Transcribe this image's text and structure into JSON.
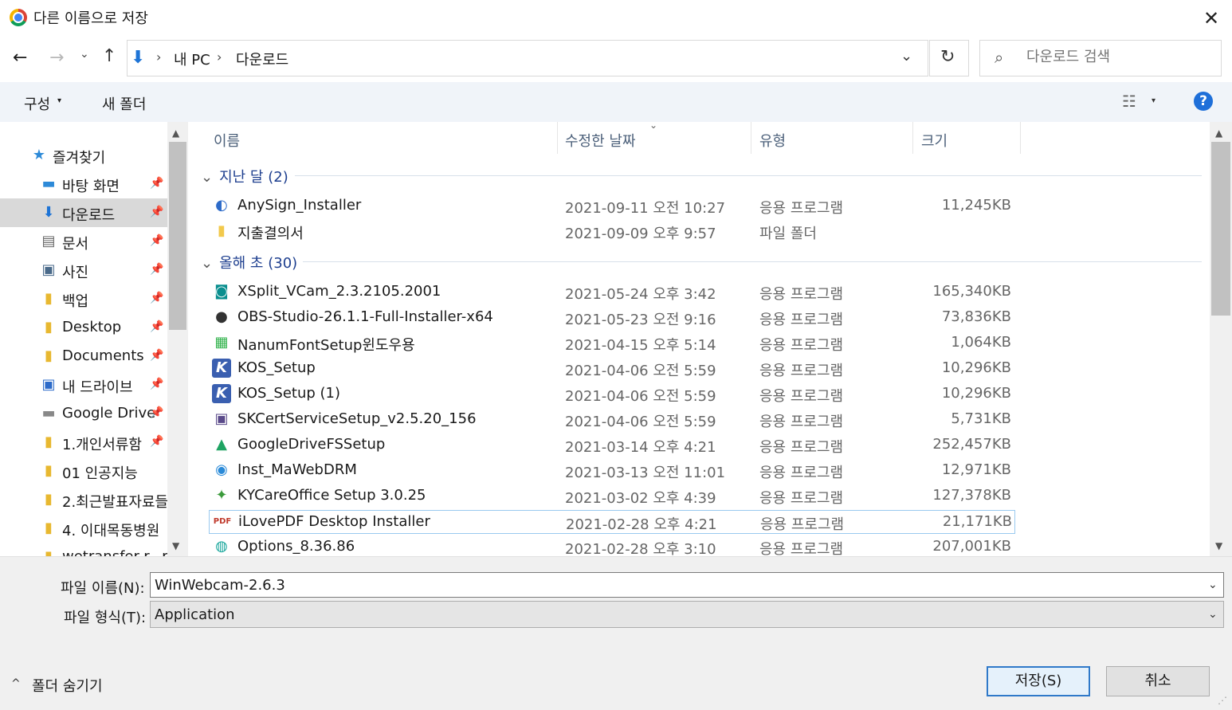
{
  "window": {
    "title": "다른 이름으로 저장",
    "close": "✕"
  },
  "nav": {
    "back": "←",
    "forward": "→",
    "recent": "⌄",
    "up": "↑"
  },
  "address": {
    "icon": "download-arrow-icon",
    "sep": "›",
    "crumbs": [
      "내 PC",
      "다운로드"
    ],
    "dropdown": "⌄"
  },
  "refresh": "↻",
  "search": {
    "placeholder": "다운로드 검색",
    "icon": "⌕"
  },
  "toolbar": {
    "organize": "구성",
    "organize_arrow": "▾",
    "new_folder": "새 폴더",
    "view_icon": "☷",
    "view_arrow": "▾",
    "help": "?"
  },
  "sidebar": {
    "items": [
      {
        "label": "즐겨찾기",
        "icon": "★",
        "pin": ""
      },
      {
        "label": "바탕 화면",
        "icon": "▬",
        "pin": "📌"
      },
      {
        "label": "다운로드",
        "icon": "⬇",
        "pin": "📌"
      },
      {
        "label": "문서",
        "icon": "▤",
        "pin": "📌"
      },
      {
        "label": "사진",
        "icon": "▣",
        "pin": "📌"
      },
      {
        "label": "백업",
        "icon": "▮",
        "pin": "📌"
      },
      {
        "label": "Desktop",
        "icon": "▮",
        "pin": "📌"
      },
      {
        "label": "Documents",
        "icon": "▮",
        "pin": "📌"
      },
      {
        "label": "내 드라이브",
        "icon": "▣",
        "pin": "📌"
      },
      {
        "label": "Google Drive",
        "icon": "▬",
        "pin": "📌"
      },
      {
        "label": "1.개인서류함",
        "icon": "▮",
        "pin": "📌"
      },
      {
        "label": "01 인공지능",
        "icon": "▮",
        "pin": ""
      },
      {
        "label": "2.최근발표자료들",
        "icon": "▮",
        "pin": ""
      },
      {
        "label": "4. 이대목동병원",
        "icon": "▮",
        "pin": ""
      },
      {
        "label": "wetransfer-r...p",
        "icon": "▮",
        "pin": ""
      }
    ]
  },
  "columns": {
    "name": "이름",
    "modified": "수정한 날짜",
    "type": "유형",
    "size": "크기",
    "sort": "⌄"
  },
  "groups": [
    {
      "header": "지난 달 (2)",
      "toggle": "⌄",
      "files": [
        {
          "name": "AnySign_Installer",
          "date": "2021-09-11 오전 10:27",
          "type": "응용 프로그램",
          "size": "11,245KB",
          "icon": "◐",
          "color": "#2d6bc9"
        },
        {
          "name": "지출결의서",
          "date": "2021-09-09 오후 9:57",
          "type": "파일 폴더",
          "size": "",
          "icon": "▮",
          "color": "#f2c94c"
        }
      ]
    },
    {
      "header": "올해 초 (30)",
      "toggle": "⌄",
      "files": [
        {
          "name": "XSplit_VCam_2.3.2105.2001",
          "date": "2021-05-24 오후 3:42",
          "type": "응용 프로그램",
          "size": "165,340KB",
          "icon": "◙",
          "color": "#0a8f8f"
        },
        {
          "name": "OBS-Studio-26.1.1-Full-Installer-x64",
          "date": "2021-05-23 오전 9:16",
          "type": "응용 프로그램",
          "size": "73,836KB",
          "icon": "●",
          "color": "#333333"
        },
        {
          "name": "NanumFontSetup윈도우용",
          "date": "2021-04-15 오후 5:14",
          "type": "응용 프로그램",
          "size": "1,064KB",
          "icon": "▦",
          "color": "#2fb24a"
        },
        {
          "name": "KOS_Setup",
          "date": "2021-04-06 오전 5:59",
          "type": "응용 프로그램",
          "size": "10,296KB",
          "icon": "K",
          "color": "#3a5fb0"
        },
        {
          "name": "KOS_Setup (1)",
          "date": "2021-04-06 오전 5:59",
          "type": "응용 프로그램",
          "size": "10,296KB",
          "icon": "K",
          "color": "#3a5fb0"
        },
        {
          "name": "SKCertServiceSetup_v2.5.20_156",
          "date": "2021-04-06 오전 5:59",
          "type": "응용 프로그램",
          "size": "5,731KB",
          "icon": "▣",
          "color": "#5a4a8a"
        },
        {
          "name": "GoogleDriveFSSetup",
          "date": "2021-03-14 오후 4:21",
          "type": "응용 프로그램",
          "size": "252,457KB",
          "icon": "▲",
          "color": "#1fa463"
        },
        {
          "name": "Inst_MaWebDRM",
          "date": "2021-03-13 오전 11:01",
          "type": "응용 프로그램",
          "size": "12,971KB",
          "icon": "◉",
          "color": "#2a8ad8"
        },
        {
          "name": "KYCareOffice Setup 3.0.25",
          "date": "2021-03-02 오후 4:39",
          "type": "응용 프로그램",
          "size": "127,378KB",
          "icon": "✦",
          "color": "#3c9b3c"
        },
        {
          "name": "iLovePDF Desktop Installer",
          "date": "2021-02-28 오후 4:21",
          "type": "응용 프로그램",
          "size": "21,171KB",
          "icon": "PDF",
          "color": "#c0392b"
        },
        {
          "name": "Options_8.36.86",
          "date": "2021-02-28 오후 3:10",
          "type": "응용 프로그램",
          "size": "207,001KB",
          "icon": "◍",
          "color": "#15a59a"
        }
      ]
    }
  ],
  "scroll": {
    "up": "▲",
    "down": "▼"
  },
  "bottom": {
    "filename_label": "파일 이름(N):",
    "filename_value": "WinWebcam-2.6.3",
    "filetype_label": "파일 형식(T):",
    "filetype_value": "Application",
    "dropdown": "⌄",
    "hide_arrow": "^",
    "hide_label": "폴더 숨기기",
    "save": "저장(S)",
    "cancel": "취소",
    "grip": "⋰"
  }
}
